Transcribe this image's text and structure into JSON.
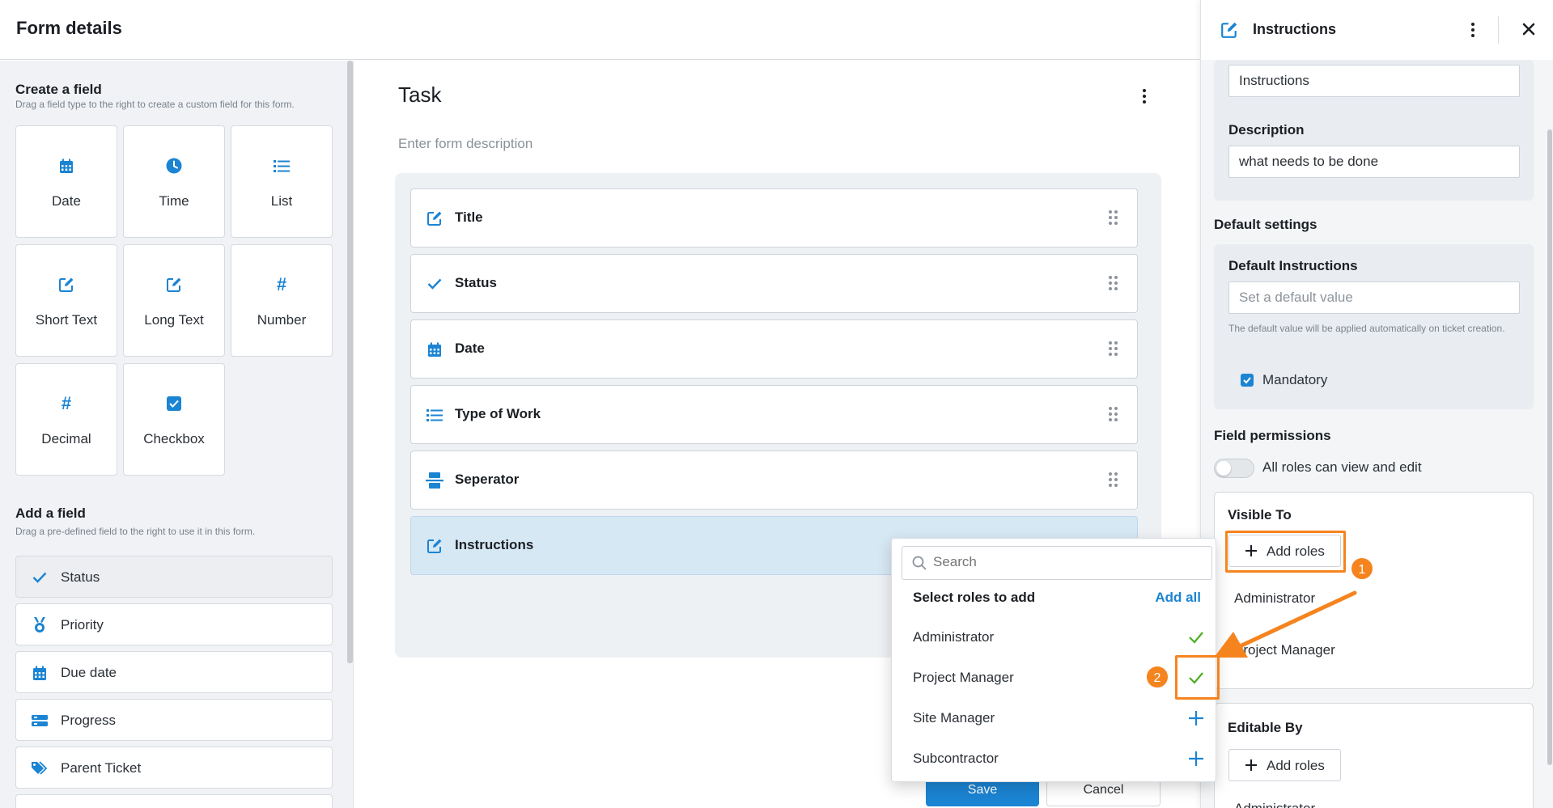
{
  "header": {
    "title": "Form details"
  },
  "left_panel": {
    "create_title": "Create a field",
    "create_sub": "Drag a field type to the right to create a custom field for this form.",
    "field_types": [
      {
        "label": "Date",
        "icon": "calendar-icon"
      },
      {
        "label": "Time",
        "icon": "clock-icon"
      },
      {
        "label": "List",
        "icon": "list-icon"
      },
      {
        "label": "Short Text",
        "icon": "edit-icon"
      },
      {
        "label": "Long Text",
        "icon": "edit-icon"
      },
      {
        "label": "Number",
        "icon": "hash-icon"
      },
      {
        "label": "Decimal",
        "icon": "hash-icon"
      },
      {
        "label": "Checkbox",
        "icon": "checkbox-icon"
      }
    ],
    "add_title": "Add a field",
    "add_sub": "Drag a pre-defined field to the right to use it in this form.",
    "predefined": [
      {
        "label": "Status",
        "icon": "check-icon"
      },
      {
        "label": "Priority",
        "icon": "medal-icon"
      },
      {
        "label": "Due date",
        "icon": "calendar-icon"
      },
      {
        "label": "Progress",
        "icon": "progress-icon"
      },
      {
        "label": "Parent Ticket",
        "icon": "tag-icon"
      }
    ]
  },
  "form": {
    "title": "Task",
    "description_placeholder": "Enter form description",
    "fields": [
      {
        "label": "Title",
        "icon": "edit-icon"
      },
      {
        "label": "Status",
        "icon": "check-icon"
      },
      {
        "label": "Date",
        "icon": "calendar-icon"
      },
      {
        "label": "Type of Work",
        "icon": "list-icon"
      },
      {
        "label": "Seperator",
        "icon": "separator-icon"
      },
      {
        "label": "Instructions",
        "icon": "edit-icon"
      }
    ],
    "save_label": "Save",
    "cancel_label": "Cancel"
  },
  "right_panel": {
    "title": "Instructions",
    "name_value": "Instructions",
    "description_label": "Description",
    "description_value": "what needs to be done",
    "default_settings_label": "Default settings",
    "default_instructions_label": "Default Instructions",
    "default_placeholder": "Set a default value",
    "default_help": "The default value will be applied automatically on ticket creation.",
    "mandatory_label": "Mandatory",
    "field_permissions_label": "Field permissions",
    "all_roles_label": "All roles can view and edit",
    "visible_to_label": "Visible To",
    "add_roles_label": "Add roles",
    "visible_roles": [
      "Administrator",
      "Project Manager"
    ],
    "editable_by_label": "Editable By",
    "editable_roles": [
      "Administrator"
    ]
  },
  "dropdown": {
    "search_placeholder": "Search",
    "header": "Select roles to add",
    "add_all": "Add all",
    "roles": [
      {
        "name": "Administrator",
        "state": "selected"
      },
      {
        "name": "Project Manager",
        "state": "selected"
      },
      {
        "name": "Site Manager",
        "state": "add"
      },
      {
        "name": "Subcontractor",
        "state": "add"
      }
    ]
  },
  "annotations": {
    "step1": "1",
    "step2": "2",
    "color": "#f5841f"
  },
  "colors": {
    "accent": "#1b84d3",
    "check_green": "#4caf1f",
    "highlight": "#f5841f"
  }
}
